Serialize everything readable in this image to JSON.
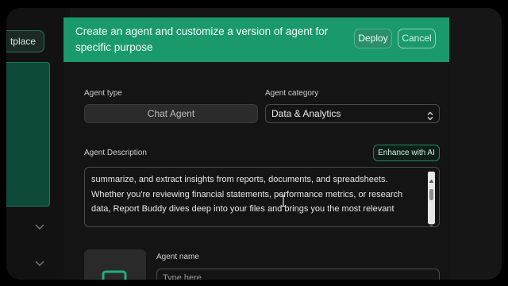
{
  "background": {
    "marketplace_label": "tplace"
  },
  "header": {
    "title": "Create an agent and customize a version of agent for specific purpose",
    "deploy_label": "Deploy",
    "cancel_label": "Cancel",
    "accent_color": "#1a9a6a"
  },
  "form": {
    "agent_type_label": "Agent type",
    "agent_type_value": "Chat Agent",
    "agent_category_label": "Agent category",
    "agent_category_value": "Data & Analytics",
    "agent_description_label": "Agent Description",
    "enhance_label": "Enhance with AI",
    "description_lines": [
      "summarize, and extract insights from reports, documents, and spreadsheets.",
      "Whether you're reviewing financial statements, performance metrics, or research",
      "data, Report Buddy dives deep into your files and brings you the most relevant"
    ],
    "agent_name_label": "Agent name",
    "agent_name_placeholder": "Type here"
  },
  "icons": [
    "chevron-down-icon",
    "select-arrows-icon",
    "scroll-up-icon",
    "scroll-down-icon",
    "agent-avatar-icon",
    "text-cursor-icon"
  ]
}
